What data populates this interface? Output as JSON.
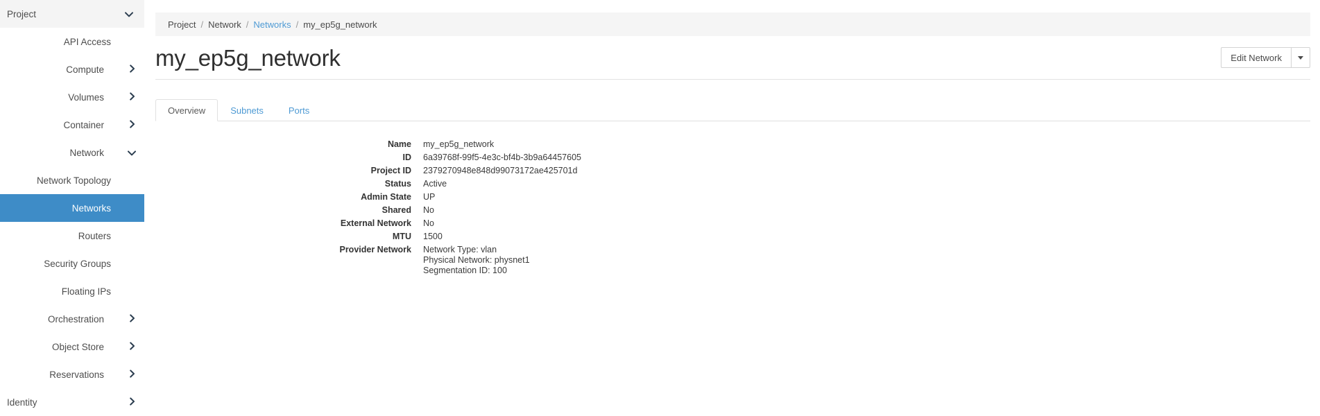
{
  "sidebar": {
    "section_header": {
      "label": "Project",
      "caret_icon": "chevron-down-icon",
      "caret_glyph": "❯"
    },
    "items": [
      {
        "label": "API Access",
        "type": "leaf",
        "active": false,
        "caret": ""
      },
      {
        "label": "Compute",
        "type": "group",
        "active": false,
        "caret": "❯"
      },
      {
        "label": "Volumes",
        "type": "group",
        "active": false,
        "caret": "❯"
      },
      {
        "label": "Container",
        "type": "group",
        "active": false,
        "caret": "❯"
      },
      {
        "label": "Network",
        "type": "group",
        "active": false,
        "caret": "❯",
        "expanded": true
      },
      {
        "label": "Network Topology",
        "type": "leaf",
        "active": false,
        "caret": ""
      },
      {
        "label": "Networks",
        "type": "leaf",
        "active": true,
        "caret": ""
      },
      {
        "label": "Routers",
        "type": "leaf",
        "active": false,
        "caret": ""
      },
      {
        "label": "Security Groups",
        "type": "leaf",
        "active": false,
        "caret": ""
      },
      {
        "label": "Floating IPs",
        "type": "leaf",
        "active": false,
        "caret": ""
      },
      {
        "label": "Orchestration",
        "type": "group",
        "active": false,
        "caret": "❯"
      },
      {
        "label": "Object Store",
        "type": "group",
        "active": false,
        "caret": "❯"
      },
      {
        "label": "Reservations",
        "type": "group",
        "active": false,
        "caret": "❯"
      },
      {
        "label": "Identity",
        "type": "root",
        "active": false,
        "caret": "❯"
      }
    ],
    "active_color": "#3e8cc7"
  },
  "breadcrumb": {
    "items": [
      {
        "label": "Project",
        "link": false
      },
      {
        "label": "Network",
        "link": false
      },
      {
        "label": "Networks",
        "link": true
      },
      {
        "label": "my_ep5g_network",
        "link": false
      }
    ],
    "separator": "/",
    "link_color": "#4e9ad4"
  },
  "header": {
    "title": "my_ep5g_network",
    "action_button": {
      "label": "Edit Network",
      "caret_icon": "caret-down-icon"
    }
  },
  "tabs": [
    {
      "label": "Overview",
      "active": true
    },
    {
      "label": "Subnets",
      "active": false
    },
    {
      "label": "Ports",
      "active": false
    }
  ],
  "overview": {
    "rows": [
      {
        "term": "Name",
        "value": "my_ep5g_network"
      },
      {
        "term": "ID",
        "value": "6a39768f-99f5-4e3c-bf4b-3b9a64457605"
      },
      {
        "term": "Project ID",
        "value": "2379270948e848d99073172ae425701d"
      },
      {
        "term": "Status",
        "value": "Active"
      },
      {
        "term": "Admin State",
        "value": "UP"
      },
      {
        "term": "Shared",
        "value": "No"
      },
      {
        "term": "External Network",
        "value": "No"
      },
      {
        "term": "MTU",
        "value": "1500"
      },
      {
        "term": "Provider Network",
        "value": "Network Type: vlan\nPhysical Network: physnet1\nSegmentation ID: 100"
      }
    ]
  }
}
